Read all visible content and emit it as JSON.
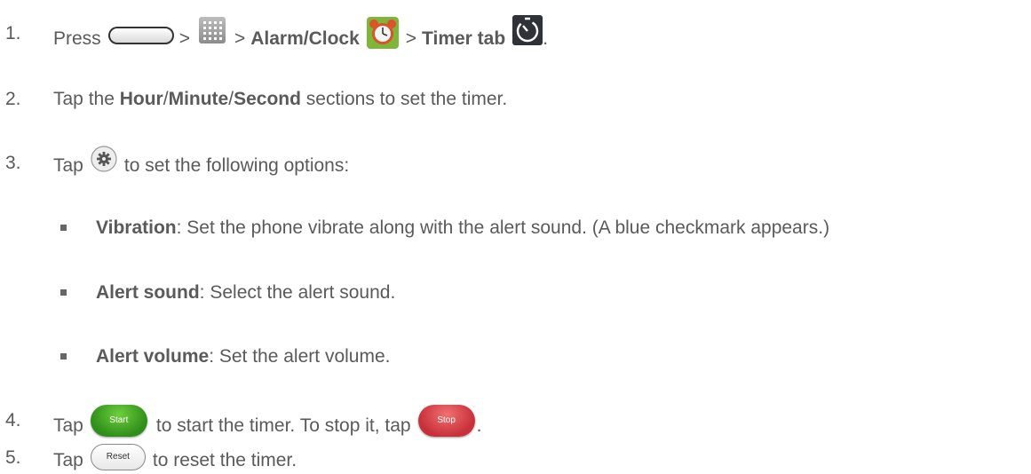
{
  "steps": [
    {
      "num": "1.",
      "press": "Press",
      "sep1": ">",
      "sep2": ">",
      "alarm": "Alarm/Clock",
      "sep3": ">",
      "timer_tab": "Timer tab",
      "end": "."
    },
    {
      "num": "2.",
      "pre": "Tap the",
      "hour": "Hour",
      "slash1": "/",
      "minute": "Minute",
      "slash2": "/",
      "second": "Second",
      "post": "sections to set the timer."
    },
    {
      "num": "3.",
      "pre": "Tap",
      "post": "to set the following options:",
      "options": [
        {
          "label": "Vibration",
          "desc": ": Set the phone vibrate along with the alert sound. (A blue checkmark appears.)"
        },
        {
          "label": "Alert sound",
          "desc": ": Select the alert sound."
        },
        {
          "label": "Alert volume",
          "desc": ": Set the alert volume."
        }
      ]
    },
    {
      "num": "4.",
      "pre": "Tap",
      "start_label": "Start",
      "mid": "to start the timer. To stop it, tap",
      "stop_label": "Stop",
      "end": "."
    },
    {
      "num": "5.",
      "pre": "Tap",
      "reset_label": "Reset",
      "post": "to reset the timer."
    }
  ],
  "icons": {
    "home": "home-key-icon",
    "apps": "apps-grid-icon",
    "clock": "alarm-clock-icon",
    "timer": "timer-icon",
    "settings": "gear-icon"
  },
  "colors": {
    "text": "#5a5a5a",
    "start": "#3fa525",
    "stop": "#d9424a"
  }
}
